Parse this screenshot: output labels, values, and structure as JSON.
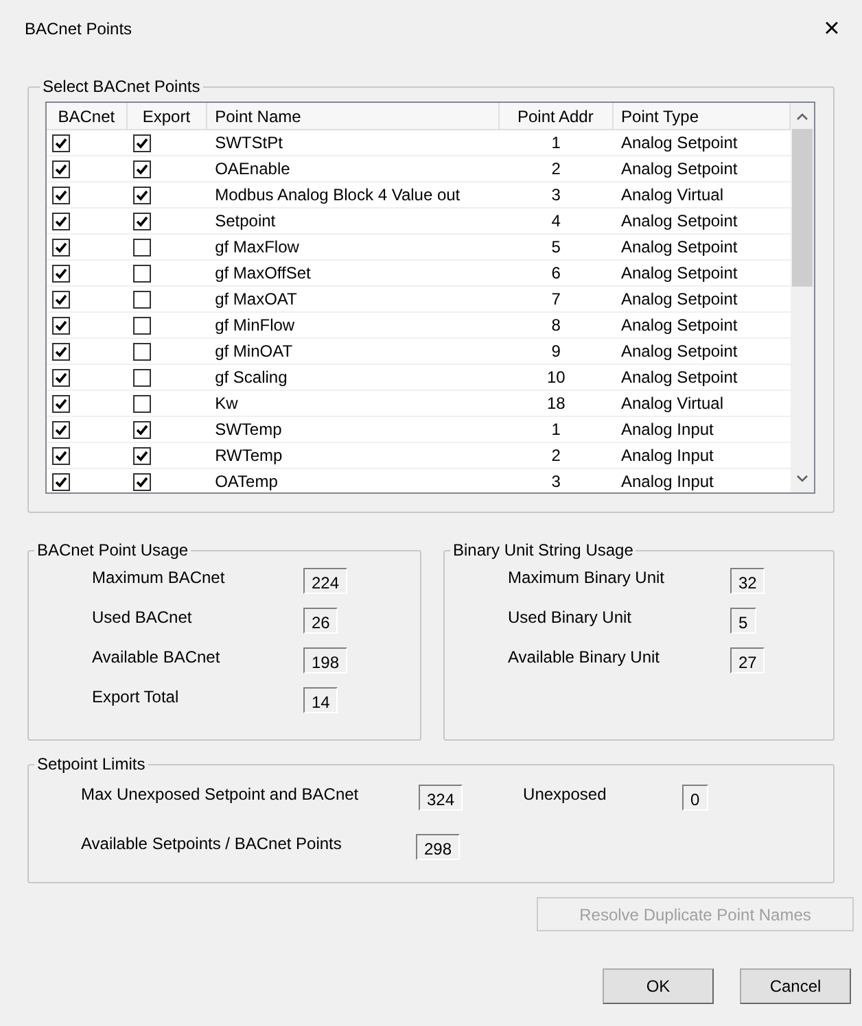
{
  "window": {
    "title": "BACnet Points",
    "close": "×"
  },
  "points_group": {
    "title": "Select BACnet Points",
    "columns": [
      "BACnet",
      "Export",
      "Point Name",
      "Point Addr",
      "Point Type"
    ],
    "rows": [
      {
        "bacnet": true,
        "export": true,
        "name": "SWTStPt",
        "addr": "1",
        "type": "Analog Setpoint"
      },
      {
        "bacnet": true,
        "export": true,
        "name": "OAEnable",
        "addr": "2",
        "type": "Analog Setpoint"
      },
      {
        "bacnet": true,
        "export": true,
        "name": "Modbus Analog Block 4 Value out",
        "addr": "3",
        "type": "Analog Virtual"
      },
      {
        "bacnet": true,
        "export": true,
        "name": "Setpoint",
        "addr": "4",
        "type": "Analog Setpoint"
      },
      {
        "bacnet": true,
        "export": false,
        "name": "gf MaxFlow",
        "addr": "5",
        "type": "Analog Setpoint"
      },
      {
        "bacnet": true,
        "export": false,
        "name": "gf MaxOffSet",
        "addr": "6",
        "type": "Analog Setpoint"
      },
      {
        "bacnet": true,
        "export": false,
        "name": "gf MaxOAT",
        "addr": "7",
        "type": "Analog Setpoint"
      },
      {
        "bacnet": true,
        "export": false,
        "name": "gf MinFlow",
        "addr": "8",
        "type": "Analog Setpoint"
      },
      {
        "bacnet": true,
        "export": false,
        "name": "gf MinOAT",
        "addr": "9",
        "type": "Analog Setpoint"
      },
      {
        "bacnet": true,
        "export": false,
        "name": "gf Scaling",
        "addr": "10",
        "type": "Analog Setpoint"
      },
      {
        "bacnet": true,
        "export": false,
        "name": "Kw",
        "addr": "18",
        "type": "Analog Virtual"
      },
      {
        "bacnet": true,
        "export": true,
        "name": "SWTemp",
        "addr": "1",
        "type": "Analog Input"
      },
      {
        "bacnet": true,
        "export": true,
        "name": "RWTemp",
        "addr": "2",
        "type": "Analog Input"
      },
      {
        "bacnet": true,
        "export": true,
        "name": "OATemp",
        "addr": "3",
        "type": "Analog Input"
      }
    ]
  },
  "bacnet_usage": {
    "title": "BACnet Point Usage",
    "fields": [
      {
        "label": "Maximum BACnet",
        "value": "224"
      },
      {
        "label": "Used BACnet",
        "value": "26"
      },
      {
        "label": "Available BACnet",
        "value": "198"
      },
      {
        "label": "Export Total",
        "value": "14"
      }
    ]
  },
  "binary_usage": {
    "title": "Binary Unit String Usage",
    "fields": [
      {
        "label": "Maximum Binary Unit",
        "value": "32"
      },
      {
        "label": "Used Binary Unit",
        "value": "5"
      },
      {
        "label": "Available Binary Unit",
        "value": "27"
      }
    ]
  },
  "setpoint_limits": {
    "title": "Setpoint Limits",
    "max_unexposed": {
      "label": "Max Unexposed Setpoint and BACnet",
      "value": "324"
    },
    "unexposed": {
      "label": "Unexposed",
      "value": "0"
    },
    "available": {
      "label": "Available Setpoints / BACnet Points",
      "value": "298"
    }
  },
  "resolve_button": {
    "label": "Resolve Duplicate Point Names",
    "disabled": true
  },
  "buttons": [
    "OK",
    "Cancel"
  ]
}
